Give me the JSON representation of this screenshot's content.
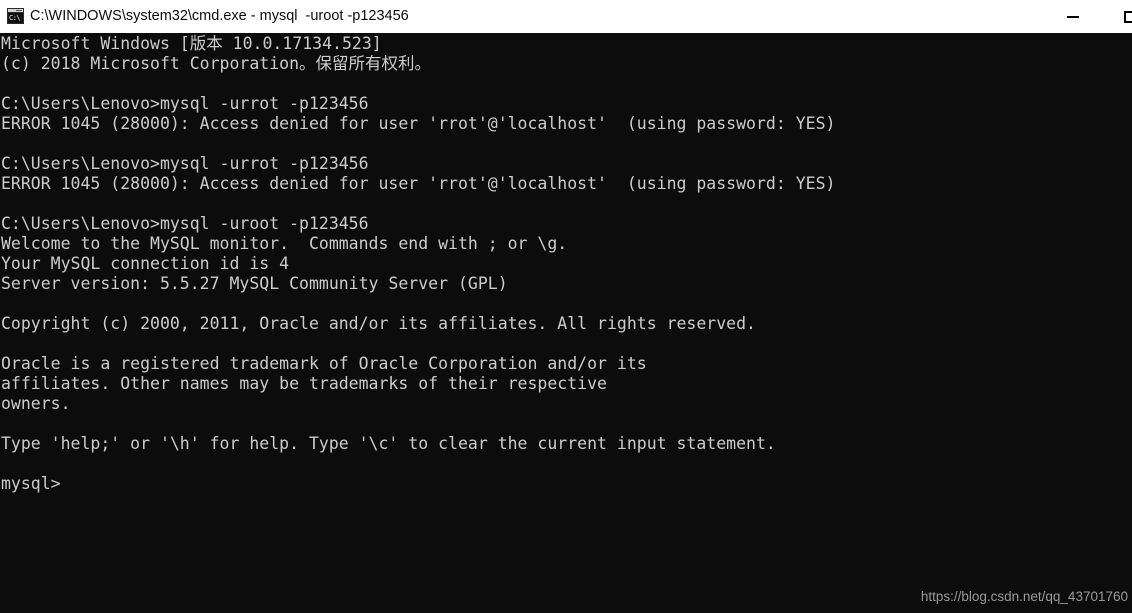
{
  "window": {
    "title": "C:\\WINDOWS\\system32\\cmd.exe - mysql  -uroot -p123456",
    "icon": "cmd-console-icon",
    "icon_glyph": "C:\\",
    "background_color": "#0c0c0c",
    "titlebar_color": "#ffffff",
    "text_color": "#cccccc"
  },
  "controls": {
    "minimize_label": "—",
    "maximize_label": "☐"
  },
  "console": {
    "lines": [
      "Microsoft Windows [版本 10.0.17134.523]",
      "(c) 2018 Microsoft Corporation。保留所有权利。",
      "",
      "C:\\Users\\Lenovo>mysql -urrot -p123456",
      "ERROR 1045 (28000): Access denied for user 'rrot'@'localhost'  (using password: YES)",
      "",
      "C:\\Users\\Lenovo>mysql -urrot -p123456",
      "ERROR 1045 (28000): Access denied for user 'rrot'@'localhost'  (using password: YES)",
      "",
      "C:\\Users\\Lenovo>mysql -uroot -p123456",
      "Welcome to the MySQL monitor.  Commands end with ; or \\g.",
      "Your MySQL connection id is 4",
      "Server version: 5.5.27 MySQL Community Server (GPL)",
      "",
      "Copyright (c) 2000, 2011, Oracle and/or its affiliates. All rights reserved.",
      "",
      "Oracle is a registered trademark of Oracle Corporation and/or its",
      "affiliates. Other names may be trademarks of their respective",
      "owners.",
      "",
      "Type 'help;' or '\\h' for help. Type '\\c' to clear the current input statement.",
      "",
      "mysql>"
    ]
  },
  "watermark": {
    "text": "https://blog.csdn.net/qq_43701760"
  }
}
